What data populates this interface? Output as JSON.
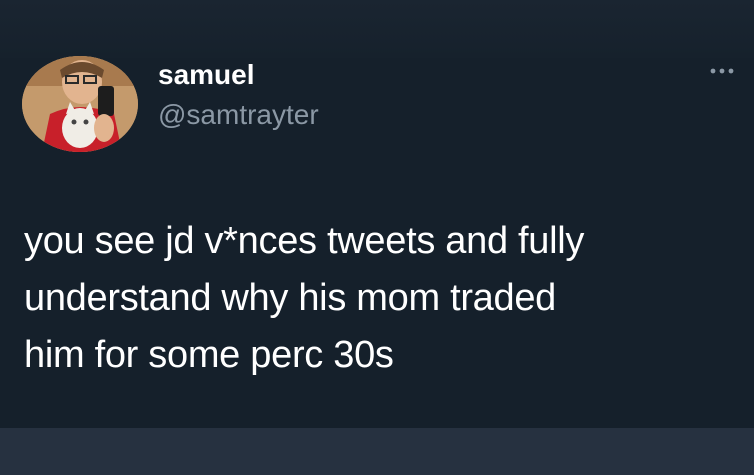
{
  "tweet": {
    "author": {
      "display_name": "samuel",
      "handle": "@samtrayter",
      "avatar_icon": "profile-photo"
    },
    "more_icon": "more-horizontal-icon",
    "text_lines": [
      "you see jd v*nces tweets and fully",
      "understand why his mom traded",
      "him for some perc 30s"
    ]
  },
  "colors": {
    "background": "#15202b",
    "text_primary": "#ffffff",
    "text_secondary": "#8b98a5"
  }
}
